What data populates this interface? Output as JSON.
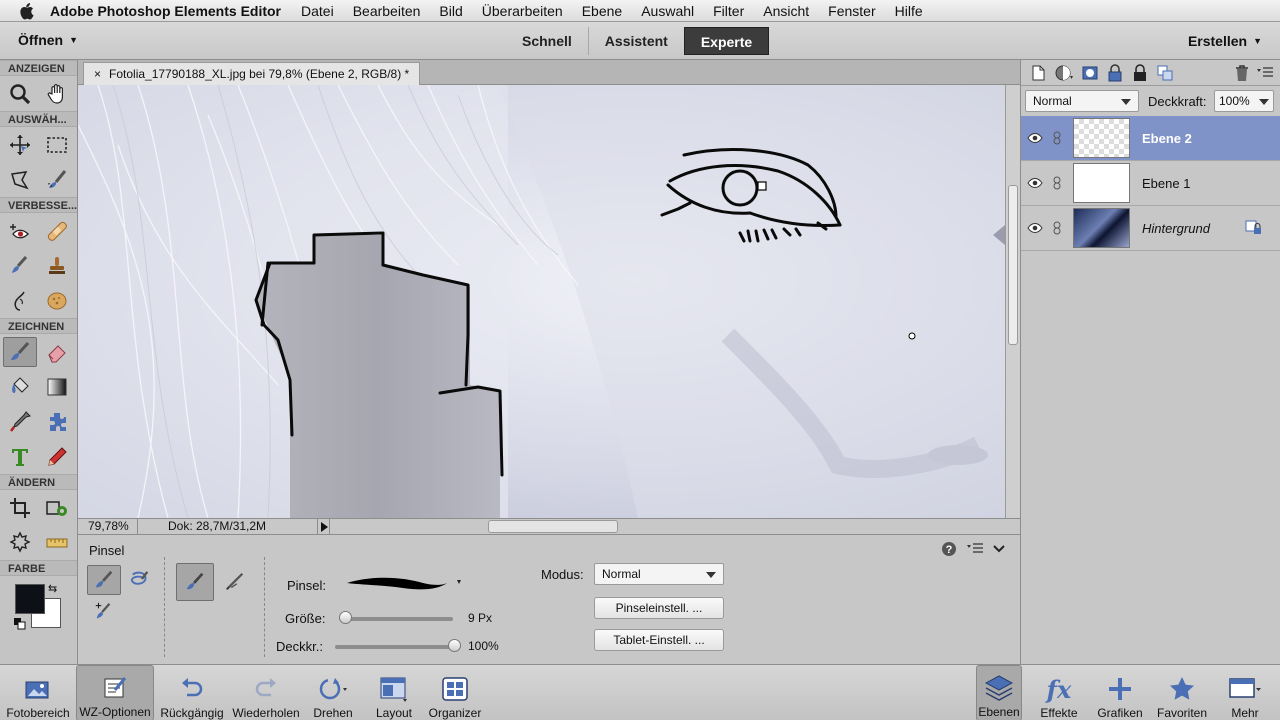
{
  "menubar": {
    "app_name": "Adobe Photoshop Elements Editor",
    "items": [
      "Datei",
      "Bearbeiten",
      "Bild",
      "Überarbeiten",
      "Ebene",
      "Auswahl",
      "Filter",
      "Ansicht",
      "Fenster",
      "Hilfe"
    ]
  },
  "topbar": {
    "open_label": "Öffnen",
    "modes": [
      "Schnell",
      "Assistent",
      "Experte"
    ],
    "active_mode": "Experte",
    "create_label": "Erstellen"
  },
  "toolbox": {
    "sections": [
      "ANZEIGEN",
      "AUSWÄH...",
      "VERBESSE...",
      "ZEICHNEN",
      "ÄNDERN",
      "FARBE"
    ],
    "foreground_color": "#0d1117",
    "background_color": "#ffffff"
  },
  "document": {
    "tab_title": "Fotolia_17790188_XL.jpg bei 79,8% (Ebene 2, RGB/8) *",
    "close_glyph": "×",
    "zoom": "79,78%",
    "doc_size": "Dok: 28,7M/31,2M"
  },
  "options": {
    "title": "Pinsel",
    "brush_label": "Pinsel:",
    "size_label": "Größe:",
    "size_value": "9 Px",
    "size_fraction": 0.05,
    "opacity_label": "Deckkr.:",
    "opacity_value": "100%",
    "opacity_fraction": 1.0,
    "mode_label": "Modus:",
    "mode_value": "Normal",
    "brush_settings_button": "Pinseleinstell. ...",
    "tablet_settings_button": "Tablet-Einstell. ..."
  },
  "layers": {
    "blend_mode": "Normal",
    "opacity_label": "Deckkraft:",
    "opacity_value": "100%",
    "items": [
      {
        "name": "Ebene 2",
        "selected": true
      },
      {
        "name": "Ebene 1",
        "selected": false
      },
      {
        "name": "Hintergrund",
        "selected": false
      }
    ]
  },
  "bottombar": {
    "left": [
      "Fotobereich",
      "WZ-Optionen",
      "Rückgängig",
      "Wiederholen",
      "Drehen",
      "Layout",
      "Organizer"
    ],
    "right": [
      "Ebenen",
      "Effekte",
      "Grafiken",
      "Favoriten",
      "Mehr"
    ]
  },
  "colors": {
    "selection_blue": "#7f93c8",
    "active_mode_bg": "#3c3c3c"
  }
}
